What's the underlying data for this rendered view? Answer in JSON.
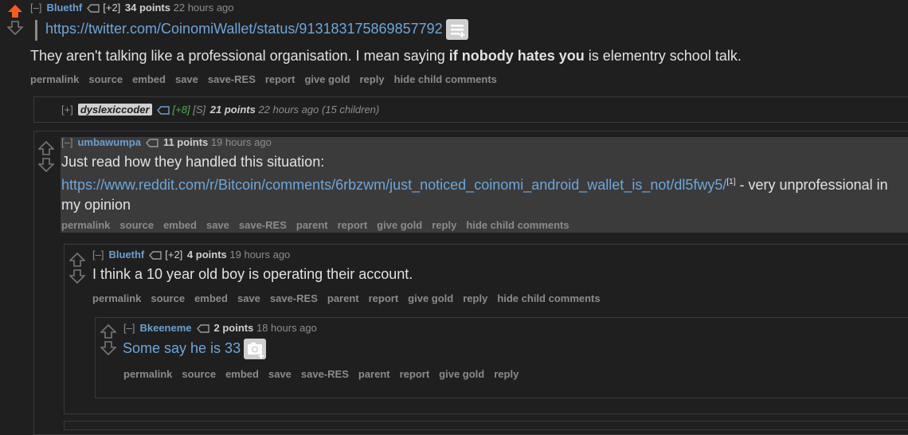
{
  "comments": [
    {
      "expand": "[–]",
      "author": "Bluethf",
      "vote_weight": "[+2]",
      "score": "34 points",
      "time": "22 hours ago",
      "link": "https://twitter.com/CoinomiWallet/status/913183175869857792",
      "body_prefix": "They aren't talking like a professional organisation. I mean saying ",
      "body_bold": "if nobody hates you",
      "body_suffix": " is elementry school talk.",
      "buttons": [
        "permalink",
        "source",
        "embed",
        "save",
        "save-RES",
        "report",
        "give gold",
        "reply",
        "hide child comments"
      ]
    },
    {
      "expand": "[+]",
      "author": "dyslexiccoder",
      "vote_weight": "[+8]",
      "submitter": "[S]",
      "score": "21 points",
      "time": "22 hours ago",
      "children": "(15 children)"
    },
    {
      "expand": "[–]",
      "author": "umbawumpa",
      "score": "11 points",
      "time": "19 hours ago",
      "body_prefix": "Just read how they handled this situation:",
      "link": "https://www.reddit.com/r/Bitcoin/comments/6rbzwm/just_noticed_coinomi_android_wallet_is_not/dl5fwy5/",
      "footnote": "[1]",
      "body_suffix": " - very unprofessional in my opinion",
      "buttons": [
        "permalink",
        "source",
        "embed",
        "save",
        "save-RES",
        "parent",
        "report",
        "give gold",
        "reply",
        "hide child comments"
      ]
    },
    {
      "expand": "[–]",
      "author": "Bluethf",
      "vote_weight": "[+2]",
      "score": "4 points",
      "time": "19 hours ago",
      "body": "I think a 10 year old boy is operating their account.",
      "buttons": [
        "permalink",
        "source",
        "embed",
        "save",
        "save-RES",
        "parent",
        "report",
        "give gold",
        "reply",
        "hide child comments"
      ]
    },
    {
      "expand": "[–]",
      "author": "Bkeeneme",
      "score": "2 points",
      "time": "18 hours ago",
      "body": "Some say he is 33",
      "buttons": [
        "permalink",
        "source",
        "embed",
        "save",
        "save-RES",
        "parent",
        "report",
        "give gold",
        "reply"
      ]
    }
  ],
  "colors": {
    "upvoted": "#ff5a1f",
    "link": "#6ea6d9",
    "background": "#1f1f1f"
  },
  "icons": [
    "upvote-arrow-icon",
    "downvote-arrow-icon",
    "tag-icon",
    "expando-text-icon",
    "expando-image-icon"
  ]
}
